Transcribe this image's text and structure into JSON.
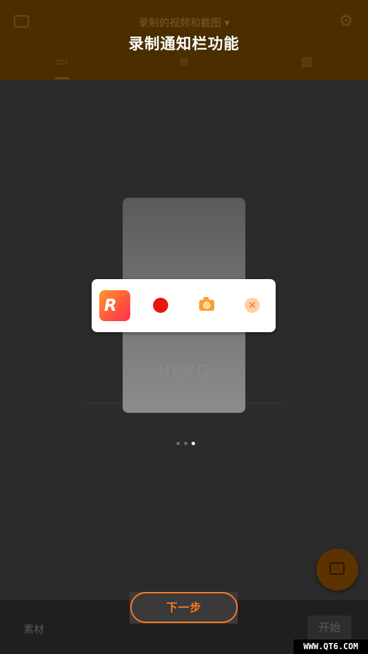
{
  "app_bar": {
    "title": "录制的视频和截图",
    "dropdown_glyph": "▾",
    "left_icon": "video-icon",
    "right_icon": "gear-icon",
    "tabs": [
      {
        "icon": "video-tab-icon",
        "glyph": "▭"
      },
      {
        "icon": "gif-tab-icon",
        "glyph": "⊗"
      },
      {
        "icon": "image-tab-icon",
        "glyph": "▨"
      }
    ]
  },
  "overlay": {
    "title": "录制通知栏功能",
    "preview_text": "HEVG",
    "notification_panel": {
      "icons": [
        "app-logo-icon",
        "record-icon",
        "screenshot-camera-icon",
        "close-icon"
      ],
      "logo_glyph": "R",
      "close_glyph": "✕"
    },
    "page_indicator": {
      "total": 3,
      "active": 3
    },
    "next_button": "下一步"
  },
  "bottom_bar": {
    "material_label": "素材",
    "start_button": "开始"
  },
  "watermark": "WWW.QT6.COM",
  "colors": {
    "accent": "#ff7a1e",
    "record_red": "#e8150e",
    "panel_bg": "#ffffff",
    "overlay_bg": "#2b2b2b"
  }
}
